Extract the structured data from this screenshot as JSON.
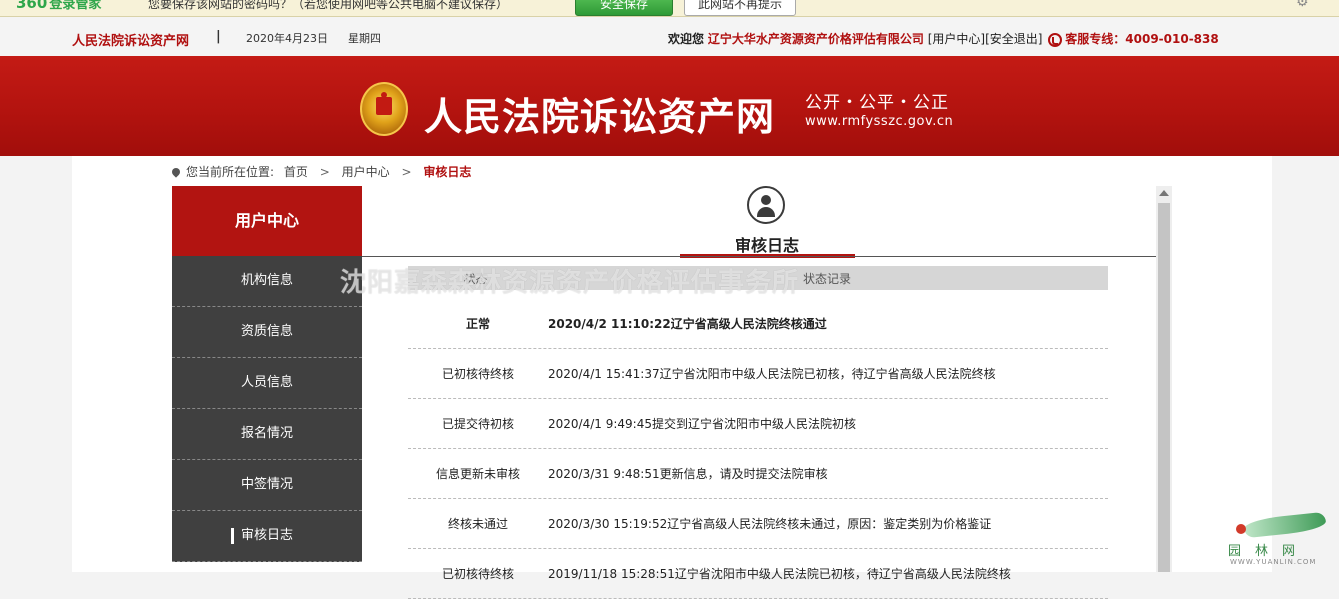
{
  "browser_bar": {
    "logo": "360",
    "logo_text": "登录管家",
    "prompt": "您要保存该网站的密码吗？（若您使用网吧等公共电脑不建议保存）",
    "save_button": "安全保存",
    "never_button": "此网站不再提示"
  },
  "topbar": {
    "site_name": "人民法院诉讼资产网",
    "separator": "|",
    "date": "2020年4月23日",
    "weekday": "星期四",
    "welcome": "欢迎您",
    "company": "辽宁大华水产资源资产价格评估有限公司",
    "user_center_link": "[用户中心]",
    "logout_link": "[安全退出]",
    "hotline": "客服专线：4009-010-838"
  },
  "banner": {
    "title": "人民法院诉讼资产网",
    "slogan": "公开・公平・公正",
    "url": "www.rmfysszc.gov.cn"
  },
  "breadcrumb": {
    "prefix": "您当前所在位置:",
    "items": [
      "首页",
      "用户中心"
    ],
    "separator": ">",
    "current": "审核日志"
  },
  "sidebar": {
    "title": "用户中心",
    "items": [
      {
        "label": "机构信息"
      },
      {
        "label": "资质信息"
      },
      {
        "label": "人员信息"
      },
      {
        "label": "报名情况"
      },
      {
        "label": "中签情况"
      },
      {
        "label": "审核日志",
        "active": true
      }
    ]
  },
  "content": {
    "title": "审核日志",
    "table": {
      "headers": [
        "状态",
        "状态记录"
      ],
      "rows": [
        {
          "status": "正常",
          "record": "2020/4/2 11:10:22辽宁省高级人民法院终核通过"
        },
        {
          "status": "已初核待终核",
          "record": "2020/4/1 15:41:37辽宁省沈阳市中级人民法院已初核，待辽宁省高级人民法院终核"
        },
        {
          "status": "已提交待初核",
          "record": "2020/4/1 9:49:45提交到辽宁省沈阳市中级人民法院初核"
        },
        {
          "status": "信息更新未审核",
          "record": "2020/3/31 9:48:51更新信息，请及时提交法院审核"
        },
        {
          "status": "终核未通过",
          "record": "2020/3/30 15:19:52辽宁省高级人民法院终核未通过，原因：鉴定类别为价格鉴证"
        },
        {
          "status": "已初核待终核",
          "record": "2019/11/18 15:28:51辽宁省沈阳市中级人民法院已初核，待辽宁省高级人民法院终核"
        }
      ]
    }
  },
  "watermark": "沈阳嘉森森林资源资产价格评估事务所",
  "corner_logo": {
    "name": "园林网",
    "sub": "WWW.YUANLIN.COM"
  },
  "colors": {
    "brand_red": "#b21411",
    "sidebar_bg": "#404040",
    "banner_red": "#c41b15"
  }
}
